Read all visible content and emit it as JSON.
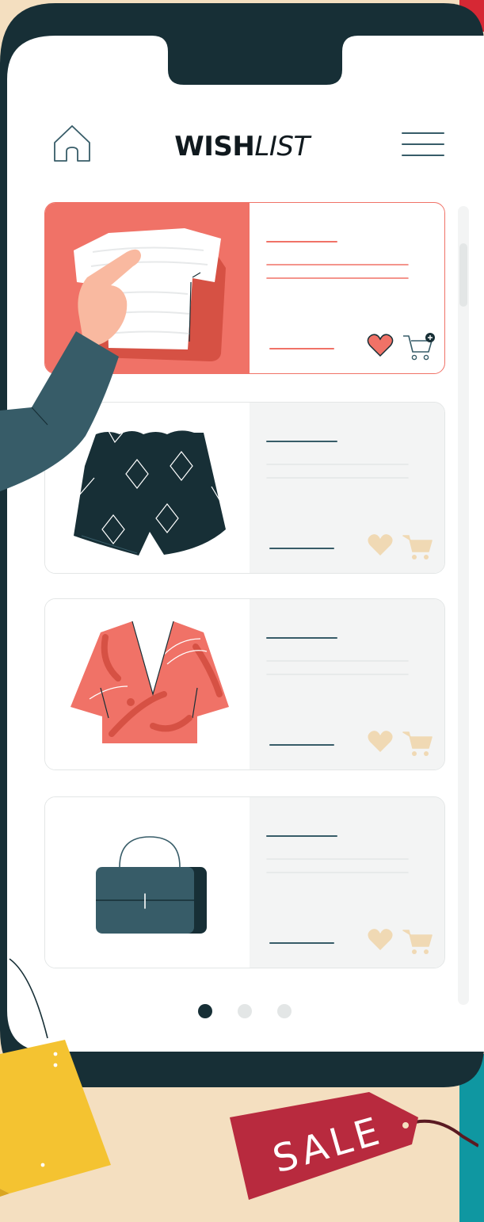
{
  "header": {
    "title_bold": "WISH",
    "title_italic": "LIST"
  },
  "wishlist": {
    "items": [
      {
        "product": "t-shirt",
        "state": "selected",
        "favorited": true
      },
      {
        "product": "shorts",
        "state": "default",
        "favorited": false
      },
      {
        "product": "blouse",
        "state": "default",
        "favorited": false
      },
      {
        "product": "handbag",
        "state": "default",
        "favorited": false
      }
    ]
  },
  "pagination": {
    "pages": 3,
    "current_page": 1
  },
  "sale_tag": {
    "text": "SALE"
  },
  "colors": {
    "accent": "#f07267",
    "dark": "#172f36",
    "slate": "#375c68",
    "tag_red": "#b82a3e",
    "bag_yellow": "#f4c331",
    "backdrop": "#f4dfc0"
  },
  "icons": {
    "home": "home-icon",
    "menu": "hamburger-menu-icon",
    "favorite": "heart-icon",
    "cart": "add-to-cart-icon"
  }
}
